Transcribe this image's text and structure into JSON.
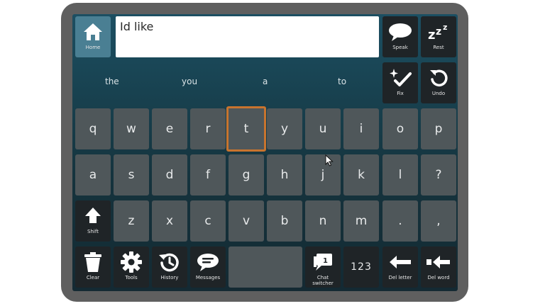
{
  "message": {
    "text": "Id like"
  },
  "top_buttons": {
    "home": "Home",
    "speak": "Speak",
    "rest": "Rest",
    "fix": "Fix",
    "undo": "Undo"
  },
  "predictions": [
    "the",
    "you",
    "a",
    "to"
  ],
  "keys": {
    "row1": [
      "q",
      "w",
      "e",
      "r",
      "t",
      "y",
      "u",
      "i",
      "o",
      "p"
    ],
    "row2": [
      "a",
      "s",
      "d",
      "f",
      "g",
      "h",
      "j",
      "k",
      "l",
      "?"
    ],
    "row3": [
      "z",
      "x",
      "c",
      "v",
      "b",
      "n",
      "m",
      ".",
      ","
    ],
    "shift": "Shift",
    "active_key": "t"
  },
  "bottom_buttons": {
    "clear": "Clear",
    "tools": "Tools",
    "history": "History",
    "messages": "Messages",
    "chat_switcher": "Chat switcher",
    "chat_count": "1",
    "numbers": "123",
    "del_letter": "Del letter",
    "del_word": "Del word"
  },
  "colors": {
    "accent": "#c8742e",
    "home": "#4a7f93",
    "key": "#4f575a",
    "dark_key": "#1f2427"
  }
}
